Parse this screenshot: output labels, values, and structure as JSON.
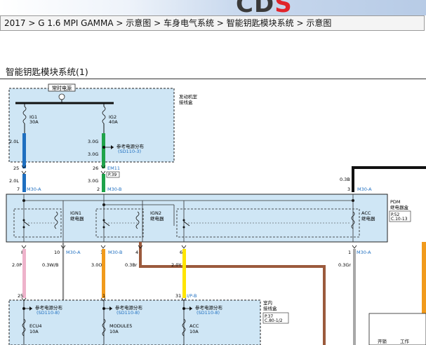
{
  "header": {
    "logo_part1": "CD",
    "logo_part2": "S"
  },
  "breadcrumb": "2017 > G 1.6 MPI GAMMA > 示意图 > 车身电气系统 > 智能钥匙模块系统 > 示意图",
  "diagram_title": "智能钥匙模块系统(1)",
  "diagram": {
    "top_box_label": "常时电源",
    "engine_box": [
      "发动机室",
      "接线盒"
    ],
    "fuses": [
      {
        "name": "IG1",
        "rating": "30A"
      },
      {
        "name": "IG2",
        "rating": "40A"
      }
    ],
    "wire_labels": {
      "w_2_0L_a": "2.0L",
      "w_3_0G_a": "3.0G",
      "w_3_0G_b": "3.0G",
      "w_2_0L_b": "2.0L",
      "w_3_0G_c": "3.0G",
      "w_0_3B": "0.3B",
      "w_2_0P": "2.0P",
      "w_0_3WB": "0.3W/B",
      "w_3_0O": "3.0O",
      "w_0_3Br": "0.3Br",
      "w_2_0Y": "2.0Y",
      "w_0_3Gr": "0.3Gr"
    },
    "ref_power": "参考电源分布",
    "ref_sd110_3": "(SD110-3)",
    "ref_sd110_8": "(SD110-8)",
    "connector_em11": "EM11",
    "connector_p39": "P.39",
    "pins": {
      "p25": "25",
      "p26": "26",
      "p7": "7",
      "p2": "2",
      "p3": "3",
      "p8": "8",
      "p10": "10",
      "p1a": "1",
      "p4": "4",
      "p6": "6",
      "p1b": "1",
      "p25b": "25",
      "p1c": "1",
      "p31": "31"
    },
    "m30a_1": "M30-A",
    "m30b_1": "M30-B",
    "m30a_2": "M30-A",
    "m30a_3": "M30-A",
    "m30b_2": "M30-B",
    "m30a_4": "M30-A",
    "relay_ign1": [
      "IGN1",
      "继电器"
    ],
    "relay_ign2": [
      "IGN2",
      "继电器"
    ],
    "relay_acc": [
      "ACC",
      "继电器"
    ],
    "pdm": [
      "PDM",
      "继电器盒"
    ],
    "pdm_ref": [
      "P.52",
      "C.10-13"
    ],
    "ip_b": "I/P-B",
    "indoor_box": [
      "室内",
      "接线盒"
    ],
    "indoor_ref": [
      "P.37",
      "C.80-1/2"
    ],
    "fuse_ecu4": [
      "ECU4",
      "10A"
    ],
    "fuse_module5": [
      "MODULE5",
      "10A"
    ],
    "fuse_acc": [
      "ACC",
      "10A"
    ],
    "bottom_right": {
      "col1": "开锁",
      "col2": "工作"
    },
    "colors": {
      "blue": "#1f6fc0",
      "green": "#1fa34a",
      "pink": "#eeb3cb",
      "orange": "#f19a1c",
      "brown": "#9b5a3d",
      "yellow": "#ffe500",
      "gray": "#a8a8a8",
      "black": "#111111",
      "box_fill": "#cfe6f5"
    }
  }
}
